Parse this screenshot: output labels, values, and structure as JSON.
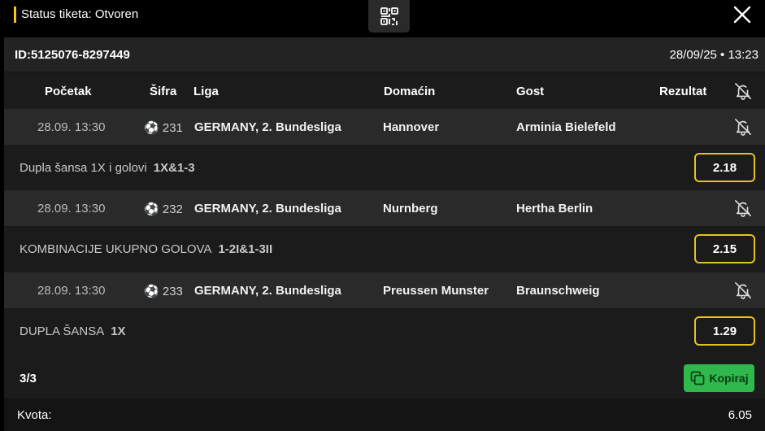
{
  "header": {
    "status_label": "Status tiketa: Otvoren"
  },
  "ticket": {
    "id": "ID:5125076-8297449",
    "datetime": "28/09/25 • 13:23"
  },
  "columns": {
    "start": "Početak",
    "code": "Šifra",
    "league": "Liga",
    "home": "Domaćin",
    "away": "Gost",
    "result": "Rezultat"
  },
  "matches": [
    {
      "time": "28.09. 13:30",
      "code": "231",
      "league": "GERMANY, 2. Bundesliga",
      "home": "Hannover",
      "away": "Arminia Bielefeld",
      "market": "Dupla šansa 1X i golovi",
      "pick": "1X&1-3",
      "odd": "2.18"
    },
    {
      "time": "28.09. 13:30",
      "code": "232",
      "league": "GERMANY, 2. Bundesliga",
      "home": "Nurnberg",
      "away": "Hertha Berlin",
      "market": "KOMBINACIJE UKUPNO GOLOVA",
      "pick": "1-2I&1-3II",
      "odd": "2.15"
    },
    {
      "time": "28.09. 13:30",
      "code": "233",
      "league": "GERMANY, 2. Bundesliga",
      "home": "Preussen Munster",
      "away": "Braunschweig",
      "market": "DUPLA ŠANSA",
      "pick": "1X",
      "odd": "1.29"
    }
  ],
  "footer": {
    "count": "3/3",
    "copy_label": "Kopiraj",
    "kvota_label": "Kvota:",
    "kvota_value": "6.05"
  },
  "colors": {
    "accent": "#f5c518",
    "odd_border": "#e3c126",
    "copy_button": "#2fb84b"
  }
}
